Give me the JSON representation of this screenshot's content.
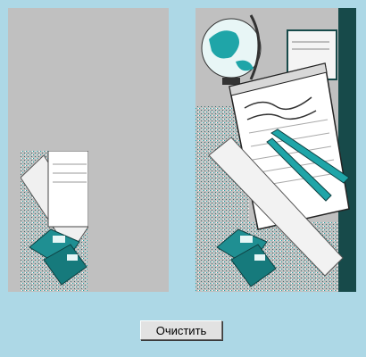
{
  "colors": {
    "background": "#add8e6",
    "panel": "#c0c0c0",
    "teal": "#1fa5a8",
    "dark_teal": "#174a4a"
  },
  "left_panel": {
    "image": "partial-study-desk-illustration"
  },
  "right_panel": {
    "image": "study-desk-illustration-globe-notepad-pencils-ruler-books"
  },
  "clear_button": {
    "label": "Очистить"
  }
}
